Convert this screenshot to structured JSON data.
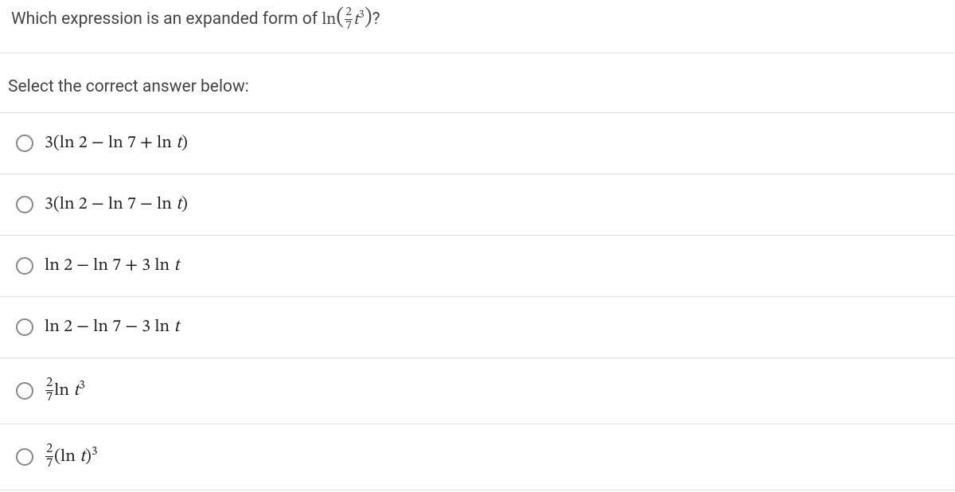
{
  "question": {
    "prefix": "Which expression is an expanded form of ",
    "ln_label": "ln",
    "frac_num": "2",
    "frac_den": "7",
    "var": "t",
    "exp": "3",
    "suffix": "?"
  },
  "prompt": "Select the correct answer below:",
  "options": [
    {
      "text": "3(ln 2 − ln 7 + ln t)"
    },
    {
      "text": "3(ln 2 − ln 7 − ln t)"
    },
    {
      "text": "ln 2 − ln 7 + 3 ln t"
    },
    {
      "text": "ln 2 − ln 7 − 3 ln t"
    }
  ],
  "option5": {
    "frac_num": "2",
    "frac_den": "7",
    "ln": "ln",
    "var": "t",
    "exp": "3"
  },
  "option6": {
    "frac_num": "2",
    "frac_den": "7",
    "ln": "(ln",
    "var": "t",
    "close": ")",
    "exp": "3"
  }
}
